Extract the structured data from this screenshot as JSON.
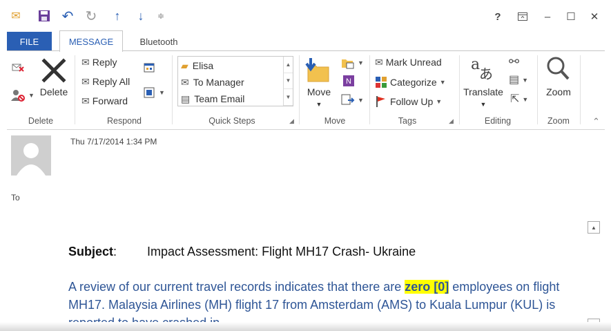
{
  "window": {
    "help": "?",
    "minimize": "–",
    "maximize": "☐",
    "close": "✕"
  },
  "tabs": {
    "file": "FILE",
    "message": "MESSAGE",
    "bluetooth": "Bluetooth"
  },
  "ribbon": {
    "delete_group": {
      "label": "Delete",
      "delete": "Delete"
    },
    "respond_group": {
      "label": "Respond",
      "reply": "Reply",
      "reply_all": "Reply All",
      "forward": "Forward"
    },
    "quick_steps_group": {
      "label": "Quick Steps",
      "items": [
        "Elisa",
        "To Manager",
        "Team Email"
      ]
    },
    "move_group": {
      "label": "Move",
      "move": "Move"
    },
    "tags_group": {
      "label": "Tags",
      "mark_unread": "Mark Unread",
      "categorize": "Categorize",
      "follow_up": "Follow Up"
    },
    "editing_group": {
      "label": "Editing",
      "translate": "Translate"
    },
    "zoom_group": {
      "label": "Zoom",
      "zoom": "Zoom"
    }
  },
  "message": {
    "date": "Thu 7/17/2014 1:34 PM",
    "to_label": "To",
    "subject_label": "Subject",
    "subject_colon": ":",
    "subject": "Impact Assessment: Flight MH17 Crash- Ukraine",
    "body_before": "A review of our current travel records indicates that there are ",
    "body_highlight": "zero [0]",
    "body_after": " employees on flight MH17. Malaysia Airlines (MH) flight 17 from Amsterdam (AMS) to Kuala Lumpur (KUL) is reported to have crashed in"
  },
  "colors": {
    "accent": "#2a5fb4",
    "body_text": "#2e5596",
    "highlight": "#ffff00"
  }
}
